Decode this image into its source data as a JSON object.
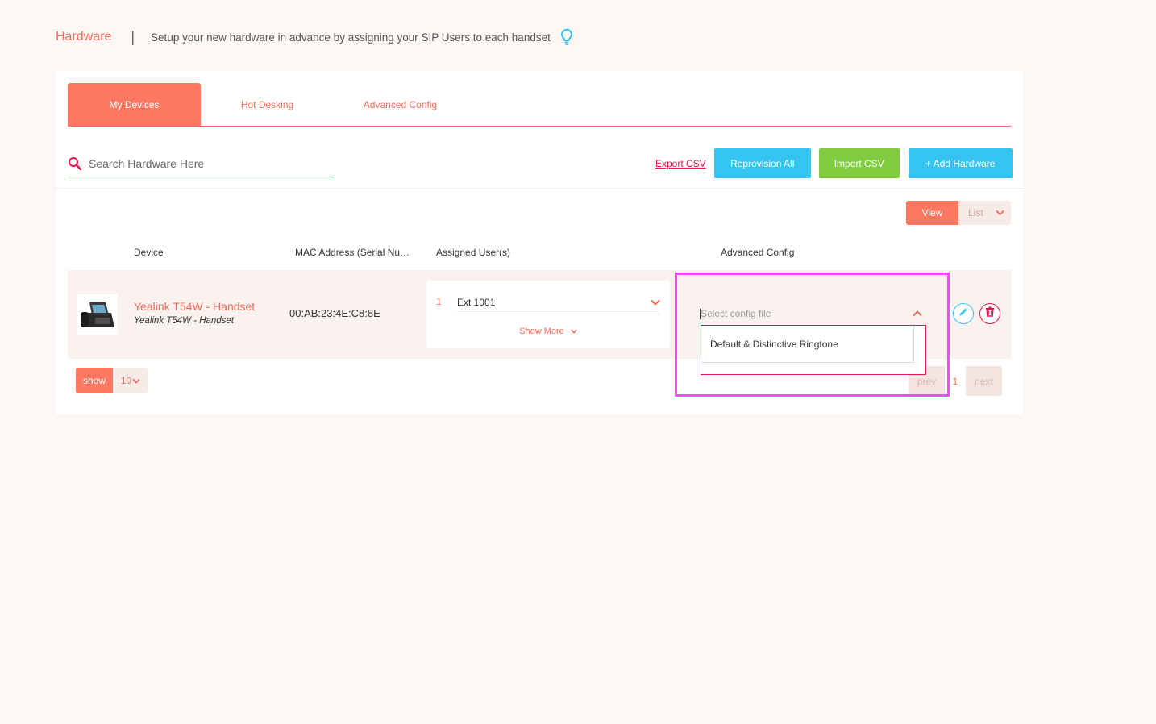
{
  "header": {
    "title": "Hardware",
    "separator": "|",
    "subtitle": "Setup your new hardware in advance by assigning your SIP Users to each handset",
    "hint_icon": "lightbulb-icon"
  },
  "tabs": [
    {
      "label": "My Devices",
      "active": true
    },
    {
      "label": "Hot Desking",
      "active": false
    },
    {
      "label": "Advanced Config",
      "active": false
    }
  ],
  "search": {
    "placeholder": "Search Hardware Here",
    "value": ""
  },
  "toolbar": {
    "export_label": "Export CSV",
    "reprovision_label": "Reprovision All",
    "import_label": "Import CSV",
    "add_label": "+ Add Hardware"
  },
  "view_toggle": {
    "view_label": "View",
    "list_label": "List"
  },
  "table": {
    "headers": {
      "device": "Device",
      "mac": "MAC Address (Serial Nu…",
      "users": "Assigned User(s)",
      "config": "Advanced Config"
    },
    "rows": [
      {
        "device_name": "Yealink T54W - Handset",
        "device_model": "Yealink T54W - Handset",
        "mac": "00:AB:23:4E:C8:8E",
        "user_index": "1",
        "user_value": "Ext 1001",
        "show_more": "Show More",
        "config_placeholder": "Select config file"
      }
    ]
  },
  "config_dropdown": {
    "options": [
      "Default & Distinctive Ringtone"
    ]
  },
  "pagination": {
    "show_label": "show",
    "page_size": "10",
    "prev_label": "prev",
    "current_page": "1",
    "next_label": "next"
  },
  "colors": {
    "accent": "#fd7761",
    "blue": "#35c4ef",
    "green": "#7fcc40",
    "highlight": "#f04ef0"
  }
}
